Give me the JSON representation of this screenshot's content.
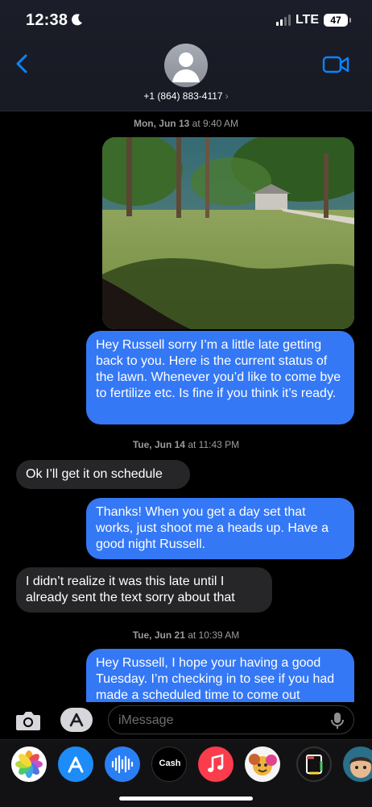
{
  "status_bar": {
    "time": "12:38",
    "network": "LTE",
    "battery": "47"
  },
  "header": {
    "contact": "+1 (864) 883-4117",
    "chevron": "›"
  },
  "messages": {
    "stamp1": {
      "day": "Mon, Jun 13",
      "time": "at 9:40 AM"
    },
    "m1": "Hey Russell sorry I’m a little late getting back to you. Here is the current status of the lawn. Whenever you’d like to come bye to fertilize etc. Is fine if you think it’s ready.",
    "stamp2": {
      "day": "Tue, Jun 14",
      "time": "at 11:43 PM"
    },
    "m2": "Ok I’ll get it on schedule",
    "m3": "Thanks! When you get a day set that works, just shoot me a heads up. Have a good night Russell.",
    "m4": "I didn’t realize it was this late until I already sent the text sorry about that",
    "stamp3": {
      "day": "Tue, Jun 21",
      "time": "at 10:39 AM"
    },
    "m5": "Hey Russell, I hope your having a good Tuesday. I’m checking in to see if you had made a scheduled time to come out"
  },
  "composer": {
    "placeholder": "iMessage"
  },
  "drawer": {
    "apps": [
      "photos-icon",
      "app-store-icon",
      "audio-message-icon",
      "cash-icon",
      "music-icon",
      "memoji-icon",
      "digital-touch-icon",
      "avatar-sticker-icon"
    ],
    "cash_label": "Cash"
  },
  "colors": {
    "outgoing": "#3478f6",
    "incoming": "#262628",
    "accent": "#0a84ff"
  }
}
